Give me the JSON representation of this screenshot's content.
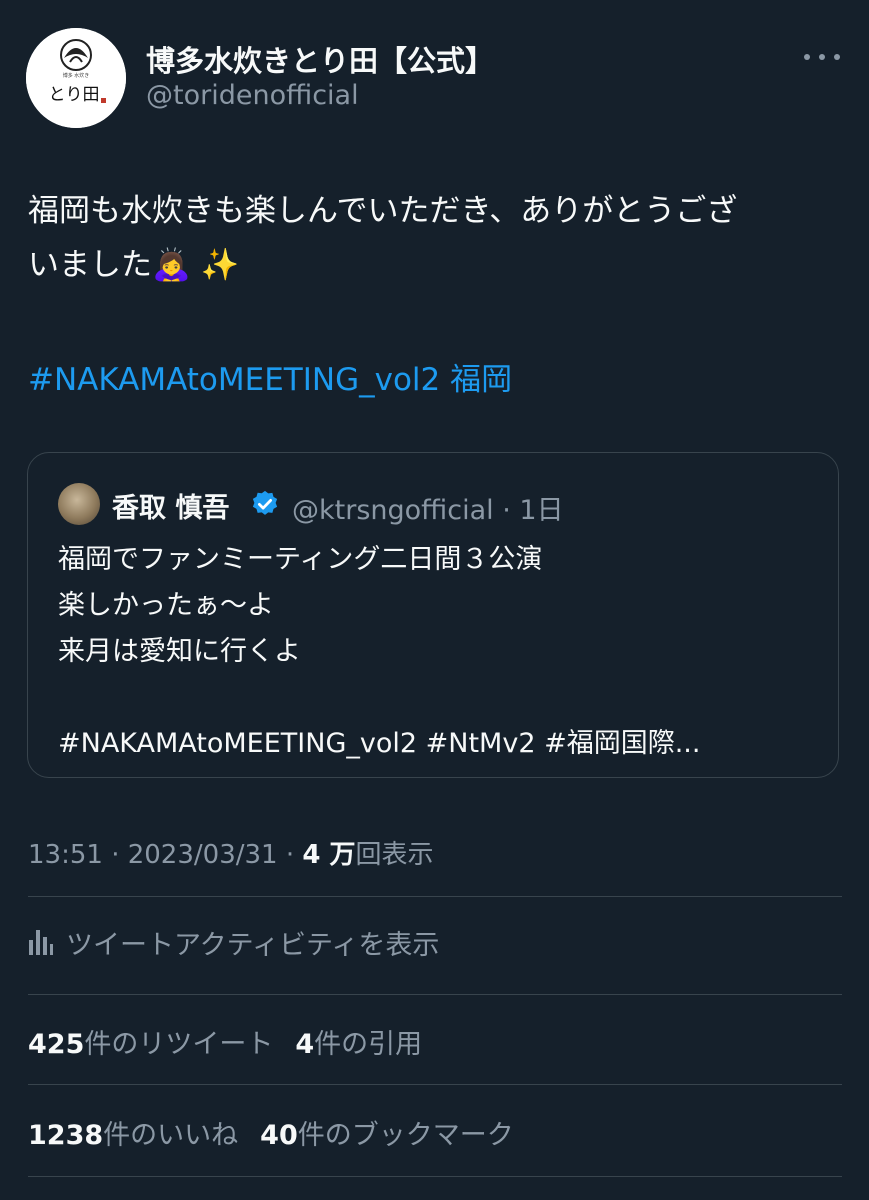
{
  "author": {
    "display_name": "博多水炊きとり田【公式】",
    "handle": "@toridenofficial",
    "avatar_text": "とり田",
    "avatar_small_text": "博多 水炊き"
  },
  "tweet": {
    "lines": [
      "福岡も水炊きも楽しんでいただき、ありがとうござ",
      "いました🙇‍♀️ ✨"
    ],
    "hashtag": "#NAKAMAtoMEETING_vol2",
    "hashtag_suffix": " 福岡"
  },
  "quote": {
    "name": "香取 慎吾",
    "handle_time": "@ktrsngofficial · 1日",
    "lines": [
      "福岡でファンミーティング二日間３公演",
      "楽しかったぁ〜よ",
      "来月は愛知に行くよ",
      "",
      "#NAKAMAtoMEETING_vol2 #NtMv2 #福岡国際..."
    ]
  },
  "meta": {
    "time_date": "13:51 · 2023/03/31 · ",
    "views_count": "4 万",
    "views_label": "回表示"
  },
  "activity_label": "ツイートアクティビティを表示",
  "stats": {
    "retweets_count": "425",
    "retweets_label": "件のリツイート",
    "quotes_count": "4",
    "quotes_label": "件の引用",
    "likes_count": "1238",
    "likes_label": "件のいいね",
    "bookmarks_count": "40",
    "bookmarks_label": "件のブックマーク"
  },
  "colors": {
    "background": "#15202b",
    "text": "#f7f9f9",
    "secondary": "#8b98a5",
    "link": "#1d9bf0",
    "border": "#38444d"
  },
  "icons": [
    "more-icon",
    "verified-badge-icon",
    "bar-chart-icon"
  ]
}
